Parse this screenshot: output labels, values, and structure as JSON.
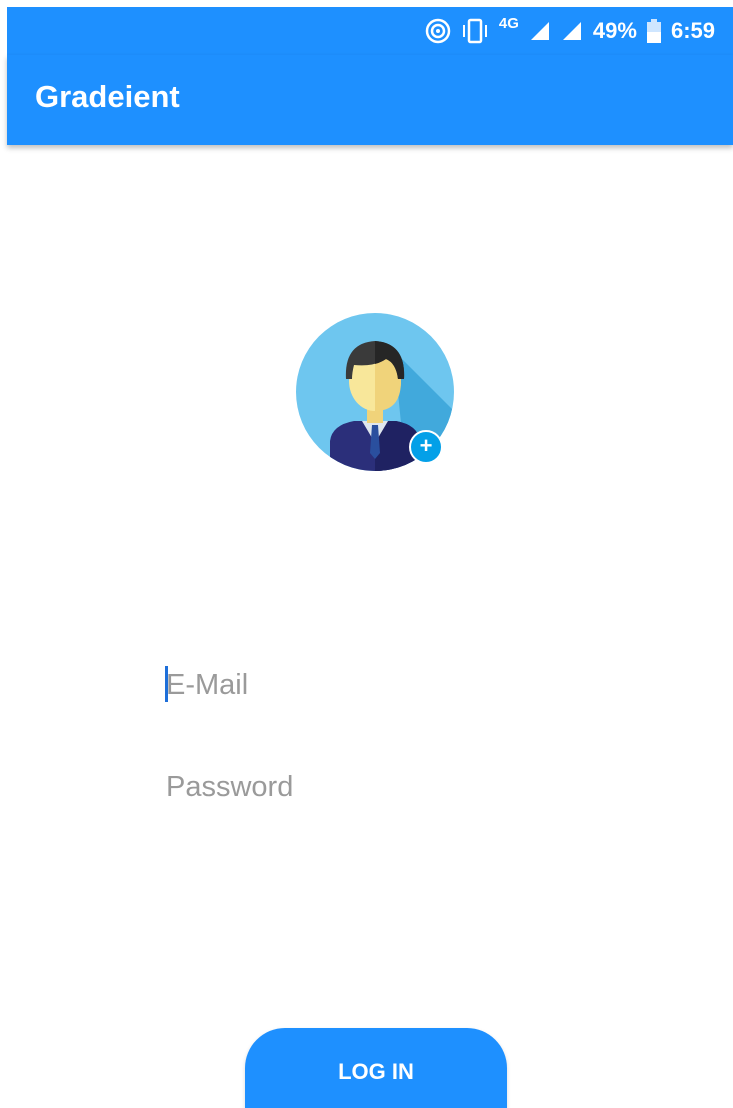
{
  "status_bar": {
    "network": "4G",
    "battery": "49%",
    "time": "6:59",
    "icons": [
      "hotspot-icon",
      "vibrate-icon",
      "signal-icon",
      "signal-icon",
      "battery-icon"
    ]
  },
  "app_bar": {
    "title": "Gradeient"
  },
  "avatar": {
    "icon": "user-avatar-icon",
    "badge_label": "+"
  },
  "form": {
    "email_placeholder": "E-Mail",
    "email_value": "",
    "password_placeholder": "Password",
    "password_value": ""
  },
  "login_button": {
    "label": "LOG IN"
  },
  "colors": {
    "primary": "#1e90ff",
    "badge": "#03a0e8",
    "placeholder": "#9a9a9a"
  }
}
